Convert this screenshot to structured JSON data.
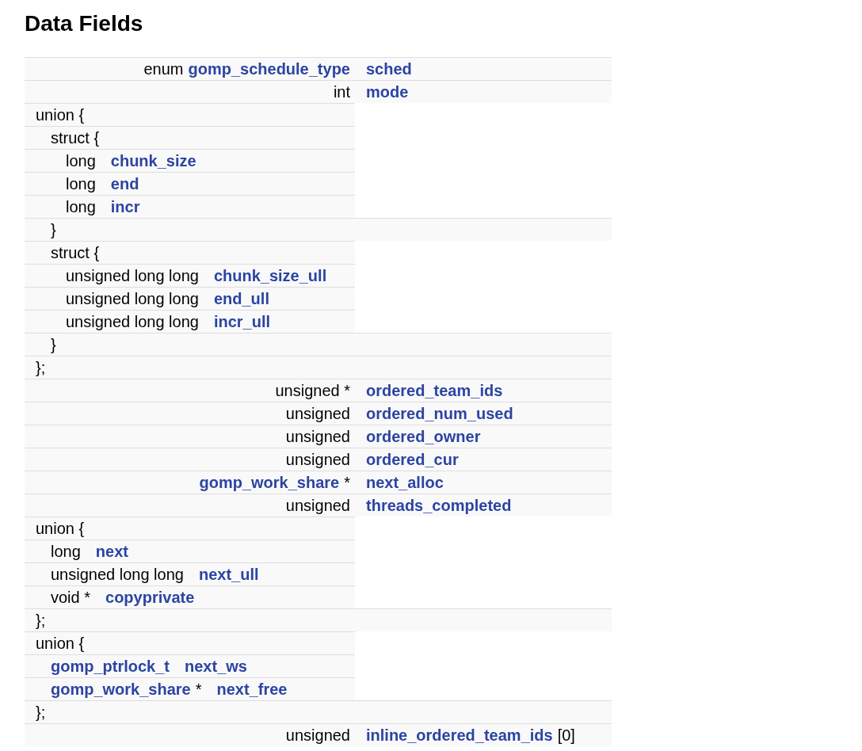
{
  "title": "Data Fields",
  "rows": [
    {
      "kind": "member",
      "type": [
        {
          "text": "enum",
          "link": false
        },
        {
          "text": "gomp_schedule_type",
          "link": true
        }
      ],
      "name": "sched"
    },
    {
      "kind": "member",
      "type": [
        {
          "text": "int",
          "link": false
        }
      ],
      "name": "mode"
    },
    {
      "kind": "block",
      "open": "union {",
      "close": "};",
      "children": [
        {
          "kind": "block",
          "open": "struct {",
          "close": "}",
          "children": [
            {
              "kind": "field",
              "type": [
                {
                  "text": "long",
                  "link": false
                }
              ],
              "name": "chunk_size"
            },
            {
              "kind": "field",
              "type": [
                {
                  "text": "long",
                  "link": false
                }
              ],
              "name": "end"
            },
            {
              "kind": "field",
              "type": [
                {
                  "text": "long",
                  "link": false
                }
              ],
              "name": "incr"
            }
          ]
        },
        {
          "kind": "block",
          "open": "struct {",
          "close": "}",
          "children": [
            {
              "kind": "field",
              "type": [
                {
                  "text": "unsigned long long",
                  "link": false
                }
              ],
              "name": "chunk_size_ull"
            },
            {
              "kind": "field",
              "type": [
                {
                  "text": "unsigned long long",
                  "link": false
                }
              ],
              "name": "end_ull"
            },
            {
              "kind": "field",
              "type": [
                {
                  "text": "unsigned long long",
                  "link": false
                }
              ],
              "name": "incr_ull"
            }
          ]
        }
      ]
    },
    {
      "kind": "member",
      "type": [
        {
          "text": "unsigned *",
          "link": false
        }
      ],
      "name": "ordered_team_ids"
    },
    {
      "kind": "member",
      "type": [
        {
          "text": "unsigned",
          "link": false
        }
      ],
      "name": "ordered_num_used"
    },
    {
      "kind": "member",
      "type": [
        {
          "text": "unsigned",
          "link": false
        }
      ],
      "name": "ordered_owner"
    },
    {
      "kind": "member",
      "type": [
        {
          "text": "unsigned",
          "link": false
        }
      ],
      "name": "ordered_cur"
    },
    {
      "kind": "member",
      "type": [
        {
          "text": "gomp_work_share",
          "link": true
        },
        {
          "text": "*",
          "link": false
        }
      ],
      "name": "next_alloc"
    },
    {
      "kind": "member",
      "type": [
        {
          "text": "unsigned",
          "link": false
        }
      ],
      "name": "threads_completed"
    },
    {
      "kind": "block",
      "open": "union {",
      "close": "};",
      "children": [
        {
          "kind": "field",
          "type": [
            {
              "text": "long",
              "link": false
            }
          ],
          "name": "next"
        },
        {
          "kind": "field",
          "type": [
            {
              "text": "unsigned long long",
              "link": false
            }
          ],
          "name": "next_ull"
        },
        {
          "kind": "field",
          "type": [
            {
              "text": "void *",
              "link": false
            }
          ],
          "name": "copyprivate"
        }
      ]
    },
    {
      "kind": "block",
      "open": "union {",
      "close": "};",
      "children": [
        {
          "kind": "field",
          "type": [
            {
              "text": "gomp_ptrlock_t",
              "link": true
            }
          ],
          "name": "next_ws"
        },
        {
          "kind": "field",
          "type": [
            {
              "text": "gomp_work_share",
              "link": true
            },
            {
              "text": "*",
              "link": false
            }
          ],
          "name": "next_free"
        }
      ]
    },
    {
      "kind": "member",
      "type": [
        {
          "text": "unsigned",
          "link": false
        }
      ],
      "name": "inline_ordered_team_ids",
      "suffix": "[0]"
    }
  ]
}
